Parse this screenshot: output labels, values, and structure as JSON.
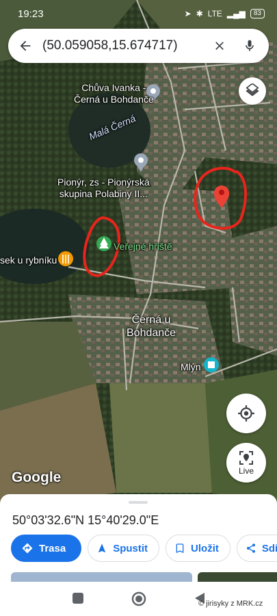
{
  "status_bar": {
    "time": "19:23",
    "network": "LTE",
    "battery": "83"
  },
  "search": {
    "query": "(50.059058,15.674717)"
  },
  "map": {
    "labels": {
      "chuva_line1": "Chůva Ivanka -",
      "chuva_line2": "Černá u Bohdanče",
      "mala_cerna": "Malá Černá",
      "pionyr_line1": "Pionýr, zs - Pionýrská",
      "pionyr_line2": "skupina Polabiny II...",
      "verejne_hriste": "Veřejné hřiště",
      "rybnik": "sek u rybníku",
      "cerna_line1": "Černá u",
      "cerna_line2": "Bohdanče",
      "mlyn": "Mlýn"
    },
    "logo": "Google",
    "live_label": "Live",
    "colors": {
      "pin": "#ea4335",
      "annotation": "#e8251c",
      "accent": "#1a73e8",
      "park": "#34a853"
    }
  },
  "sheet": {
    "coordinates": "50°03'32.6\"N 15°40'29.0\"E",
    "actions": [
      "Trasa",
      "Spustit",
      "Uložit",
      "Sdíle"
    ]
  },
  "nav": {
    "buttons": [
      "recents-icon",
      "home-icon",
      "back-icon"
    ]
  },
  "watermark": "© jirisyky z MRK.cz"
}
